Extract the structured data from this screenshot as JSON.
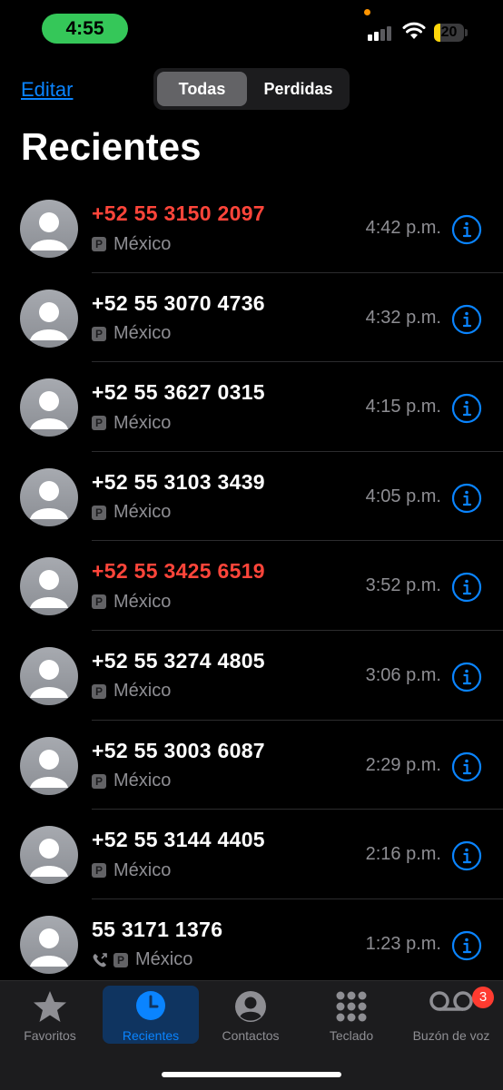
{
  "status_bar": {
    "time": "4:55",
    "battery": "20",
    "battery_level": 0.2
  },
  "header": {
    "edit_label": "Editar",
    "segments": [
      "Todas",
      "Perdidas"
    ],
    "title": "Recientes"
  },
  "calls": [
    {
      "number": "+52 55 3150 2097",
      "location": "México",
      "time": "4:42 p.m.",
      "missed": true
    },
    {
      "number": "+52 55 3070 4736",
      "location": "México",
      "time": "4:32 p.m.",
      "missed": false
    },
    {
      "number": "+52 55 3627 0315",
      "location": "México",
      "time": "4:15 p.m.",
      "missed": false
    },
    {
      "number": "+52 55 3103 3439",
      "location": "México",
      "time": "4:05 p.m.",
      "missed": false
    },
    {
      "number": "+52 55 3425 6519",
      "location": "México",
      "time": "3:52 p.m.",
      "missed": true
    },
    {
      "number": "+52 55 3274 4805",
      "location": "México",
      "time": "3:06 p.m.",
      "missed": false
    },
    {
      "number": "+52 55 3003 6087",
      "location": "México",
      "time": "2:29 p.m.",
      "missed": false
    },
    {
      "number": "+52 55 3144 4405",
      "location": "México",
      "time": "2:16 p.m.",
      "missed": false
    },
    {
      "number": "55 3171 1376",
      "location": "México",
      "time": "1:23 p.m.",
      "missed": false,
      "outgoing": true
    }
  ],
  "tabs": [
    {
      "label": "Favoritos",
      "icon": "star-icon"
    },
    {
      "label": "Recientes",
      "icon": "clock-icon",
      "active": true
    },
    {
      "label": "Contactos",
      "icon": "person-circle-icon"
    },
    {
      "label": "Teclado",
      "icon": "keypad-icon"
    },
    {
      "label": "Buzón de voz",
      "icon": "voicemail-icon",
      "badge": "3"
    }
  ],
  "colors": {
    "accent": "#0a84ff",
    "missed": "#ff453a",
    "status_pill": "#35c759",
    "battery": "#ffd60a"
  }
}
